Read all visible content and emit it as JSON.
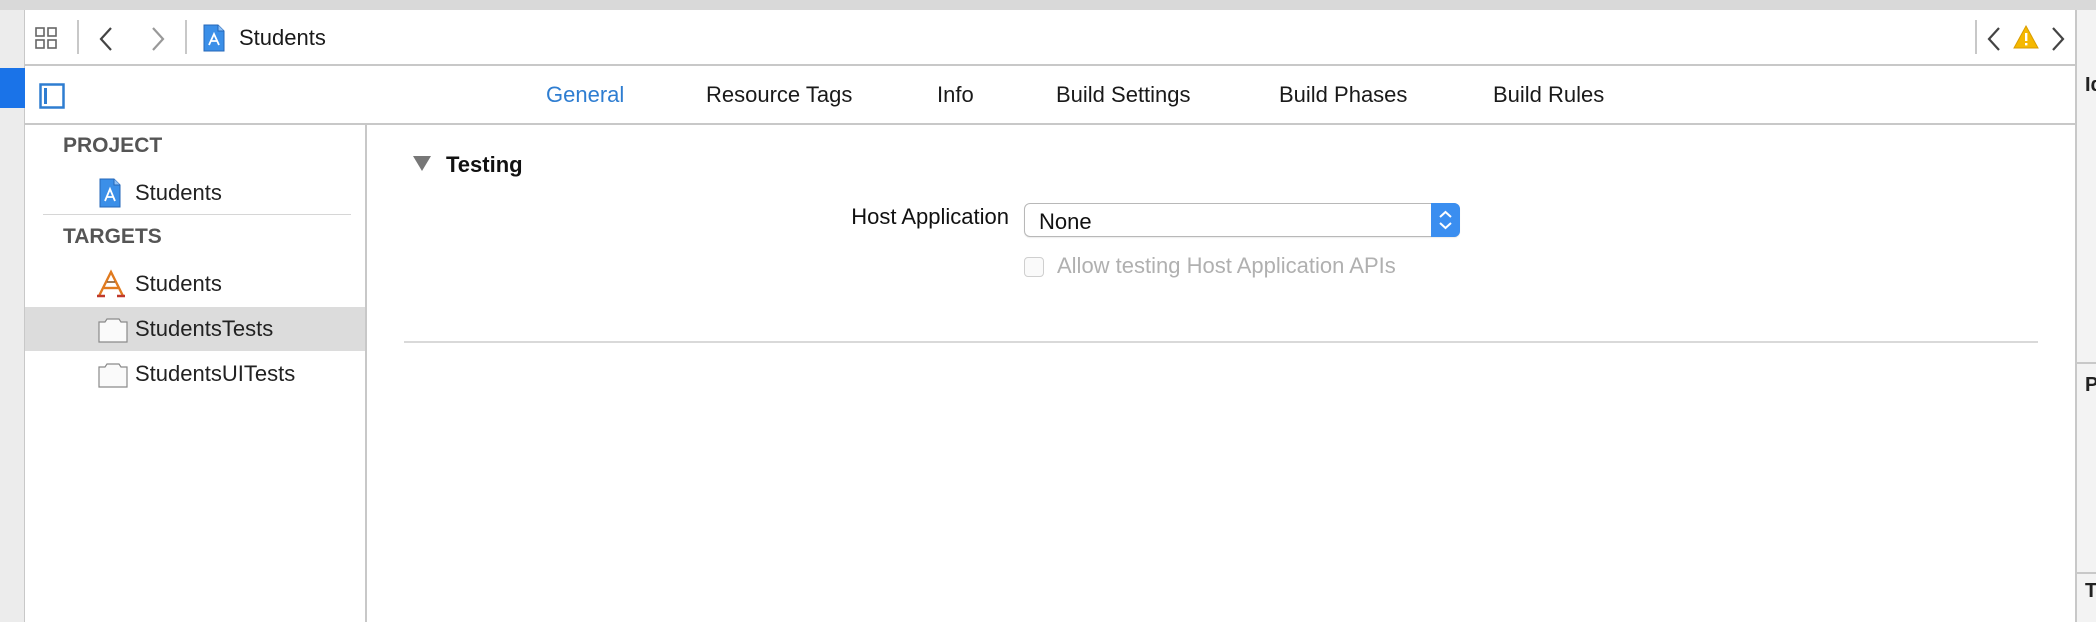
{
  "jumpbar": {
    "breadcrumb_label": "Students",
    "icons": [
      "grid-icon",
      "back-chevron-icon",
      "forward-chevron-icon",
      "xcode-project-icon",
      "issue-back-chevron-icon",
      "warning-icon",
      "issue-forward-chevron-icon"
    ],
    "warning_color": "#f5b800"
  },
  "tabs": [
    {
      "label": "General",
      "active": true
    },
    {
      "label": "Resource Tags",
      "active": false
    },
    {
      "label": "Info",
      "active": false
    },
    {
      "label": "Build Settings",
      "active": false
    },
    {
      "label": "Build Phases",
      "active": false
    },
    {
      "label": "Build Rules",
      "active": false
    }
  ],
  "sidebar": {
    "project_header": "PROJECT",
    "project_items": [
      {
        "label": "Students",
        "icon": "project-file-icon"
      }
    ],
    "targets_header": "TARGETS",
    "target_items": [
      {
        "label": "Students",
        "icon": "app-target-icon",
        "selected": false
      },
      {
        "label": "StudentsTests",
        "icon": "test-bundle-icon",
        "selected": true
      },
      {
        "label": "StudentsUITests",
        "icon": "test-bundle-icon",
        "selected": false
      }
    ]
  },
  "testing": {
    "section_title": "Testing",
    "host_label": "Host Application",
    "host_value": "None",
    "allow_label": "Allow testing Host Application APIs",
    "allow_checked": false,
    "allow_enabled": false
  },
  "right_panel": {
    "letters": [
      "Id",
      "P",
      "T"
    ]
  },
  "colors": {
    "accent": "#2e7dd1",
    "selection": "#dcdcdc",
    "stepper": "#3a8ef0"
  }
}
